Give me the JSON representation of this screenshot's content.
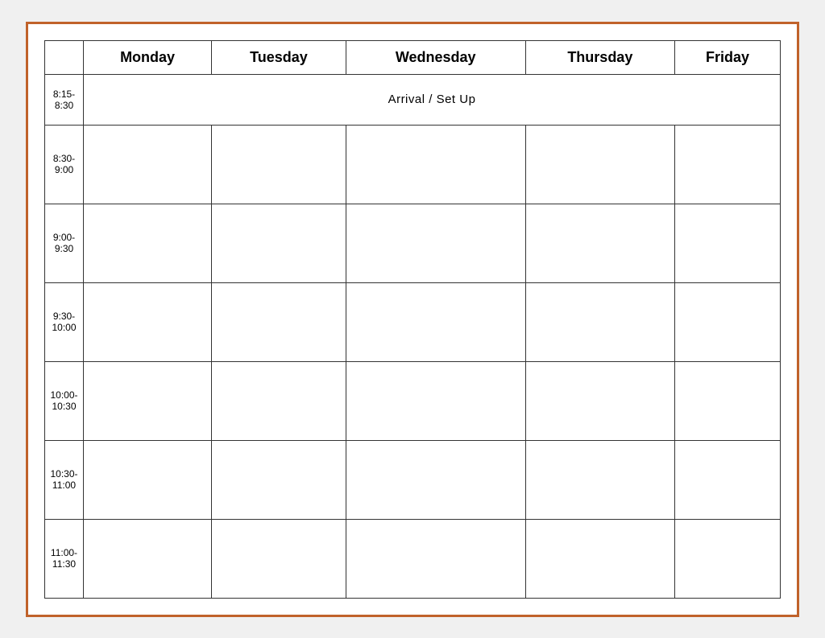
{
  "table": {
    "headers": [
      "",
      "Monday",
      "Tuesday",
      "Wednesday",
      "Thursday",
      "Friday"
    ],
    "arrival_text": "Arrival / Set Up",
    "time_slots": [
      "8:15-\n8:30",
      "8:30-\n9:00",
      "9:00-\n9:30",
      "9:30-\n10:00",
      "10:00-\n10:30",
      "10:30-\n11:00",
      "11:00-\n11:30"
    ]
  }
}
